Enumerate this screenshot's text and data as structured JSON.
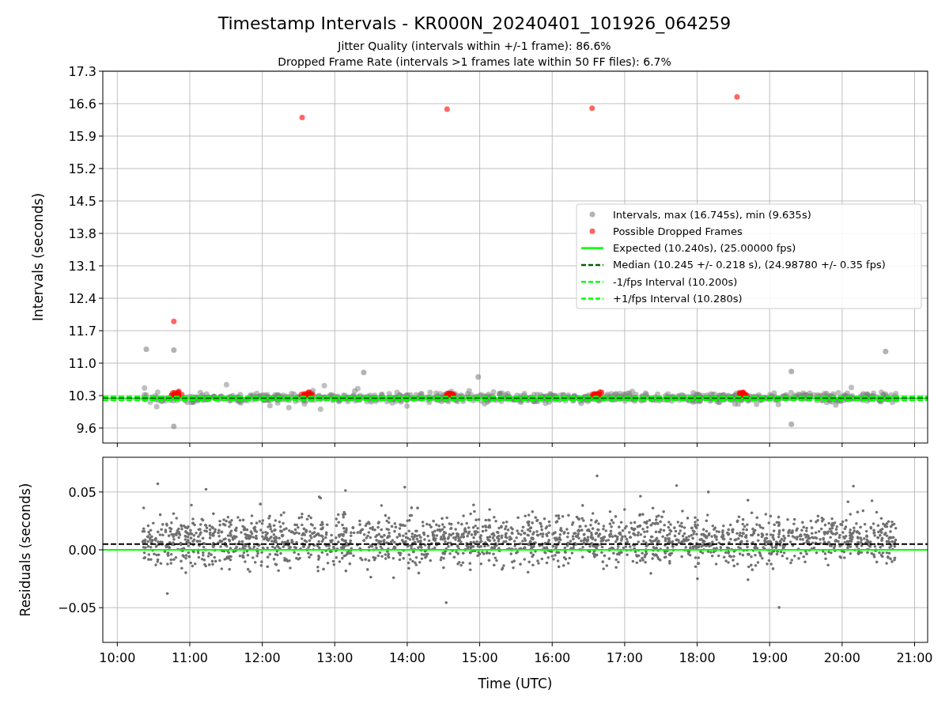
{
  "title": "Timestamp Intervals - KR000N_20240401_101926_064259",
  "subtitles": [
    "Jitter Quality (intervals within +/-1 frame): 86.6%",
    "Dropped Frame Rate (intervals >1 frames late within 50 FF files): 6.7%"
  ],
  "intervals_plot": {
    "chart_data": {
      "type": "scatter",
      "grid": true,
      "ylabel": "Intervals (seconds)",
      "xlim": [
        9.8,
        21.18
      ],
      "ylim": [
        9.276,
        17.3
      ],
      "yticks": [
        {
          "value": 9.6,
          "label": "9.6"
        },
        {
          "value": 10.3,
          "label": "10.3"
        },
        {
          "value": 11.0,
          "label": "11.0"
        },
        {
          "value": 11.7,
          "label": "11.7"
        },
        {
          "value": 12.4,
          "label": "12.4"
        },
        {
          "value": 13.1,
          "label": "13.1"
        },
        {
          "value": 13.8,
          "label": "13.8"
        },
        {
          "value": 14.5,
          "label": "14.5"
        },
        {
          "value": 15.2,
          "label": "15.2"
        },
        {
          "value": 15.9,
          "label": "15.9"
        },
        {
          "value": 16.6,
          "label": "16.6"
        },
        {
          "value": 17.3,
          "label": "17.3"
        }
      ],
      "series": [
        {
          "name": "Intervals, max (16.745s), min (9.635s)",
          "color": "#808080",
          "x": [
            10.4,
            10.78,
            20.6,
            13.4,
            19.3,
            14.98,
            10.78,
            19.3
          ],
          "values": [
            11.3,
            11.28,
            11.25,
            10.8,
            10.82,
            10.7,
            9.635,
            9.68
          ]
        },
        {
          "name": "Possible Dropped Frames",
          "color": "#ff0000",
          "x": [
            12.55,
            14.55,
            16.55,
            18.55,
            10.78
          ],
          "values": [
            16.3,
            16.48,
            16.5,
            16.745,
            11.9
          ]
        }
      ],
      "ref_lines": [
        {
          "axis": "y",
          "value": 10.24,
          "label": "Expected (10.240s), (25.00000 fps)",
          "color": "#00ff00"
        },
        {
          "axis": "y",
          "value": 10.245,
          "label": "Median (10.245 +/- 0.218 s), (24.98780 +/- 0.35 fps)",
          "color": "#006400"
        },
        {
          "axis": "y",
          "value": 10.2,
          "label": "-1/fps Interval (10.200s)",
          "color": "#00ff00"
        },
        {
          "axis": "y",
          "value": 10.28,
          "label": "+1/fps Interval (10.280s)",
          "color": "#00ff00"
        }
      ]
    }
  },
  "residuals_plot": {
    "chart_data": {
      "type": "scatter",
      "grid": true,
      "xlabel": "Time (UTC)",
      "ylabel": "Residuals (seconds)",
      "xlim": [
        9.8,
        21.18
      ],
      "ylim": [
        -0.08,
        0.08
      ],
      "xticks": [
        {
          "value": 10,
          "label": "10:00"
        },
        {
          "value": 11,
          "label": "11:00"
        },
        {
          "value": 12,
          "label": "12:00"
        },
        {
          "value": 13,
          "label": "13:00"
        },
        {
          "value": 14,
          "label": "14:00"
        },
        {
          "value": 15,
          "label": "15:00"
        },
        {
          "value": 16,
          "label": "16:00"
        },
        {
          "value": 17,
          "label": "17:00"
        },
        {
          "value": 18,
          "label": "18:00"
        },
        {
          "value": 19,
          "label": "19:00"
        },
        {
          "value": 20,
          "label": "20:00"
        },
        {
          "value": 21,
          "label": "21:00"
        }
      ],
      "yticks": [
        {
          "value": -0.05,
          "label": "−0.05"
        },
        {
          "value": 0,
          "label": "0.00"
        },
        {
          "value": 0.05,
          "label": "0.05"
        }
      ],
      "ref_lines": [
        {
          "axis": "y",
          "value": 0,
          "color": "#00ff00"
        },
        {
          "axis": "y",
          "value": 0.005,
          "color": "#000000"
        }
      ]
    }
  }
}
